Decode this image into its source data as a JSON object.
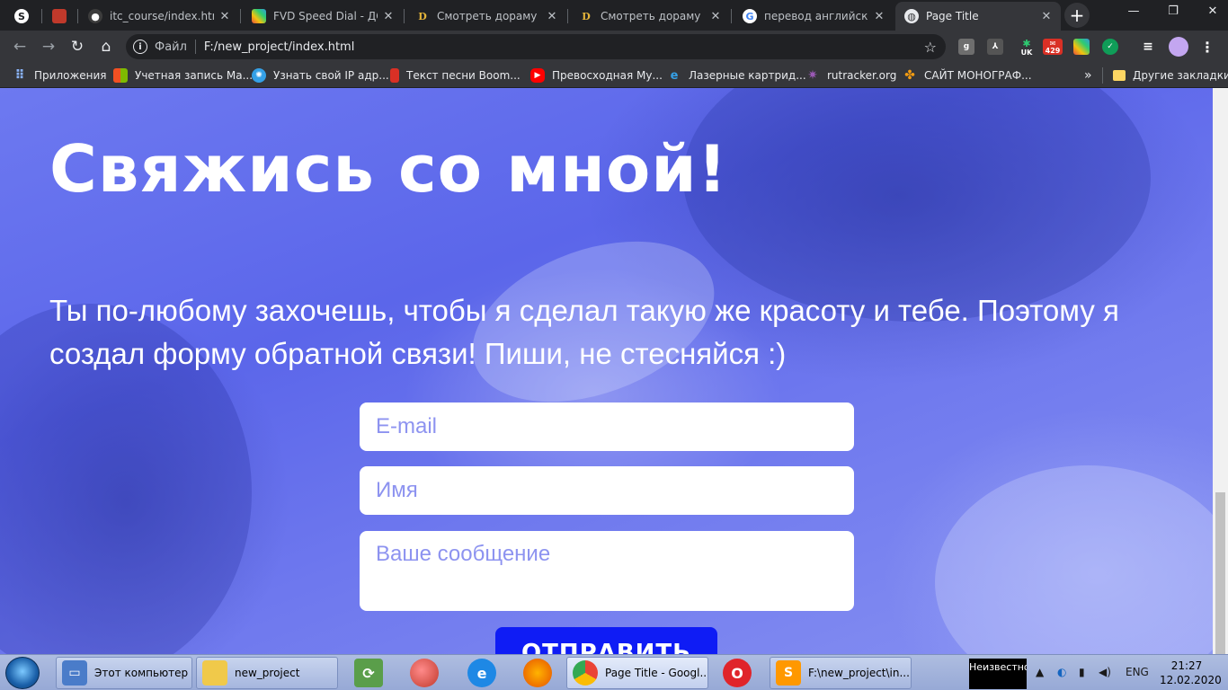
{
  "tabs": [
    {
      "title": "",
      "icon": "pinned-app-icon"
    },
    {
      "title": "",
      "icon": "pinned-site-icon"
    },
    {
      "title": "itc_course/index.html",
      "icon": "github-icon"
    },
    {
      "title": "FVD Speed Dial - ДОР",
      "icon": "speed-dial-icon"
    },
    {
      "title": "Смотреть дораму Ри",
      "icon": "dorama-icon"
    },
    {
      "title": "Смотреть дораму По",
      "icon": "dorama-icon"
    },
    {
      "title": "перевод английский",
      "icon": "google-icon"
    },
    {
      "title": "Page Title",
      "icon": "globe-icon"
    }
  ],
  "address": {
    "scheme": "Файл",
    "url": "F:/new_project/index.html"
  },
  "extensions": {
    "badge_uk": "UK",
    "badge_count": "429"
  },
  "bookmarks": [
    {
      "label": "Приложения",
      "icon": "apps-icon"
    },
    {
      "label": "Учетная запись Ма...",
      "icon": "microsoft-icon"
    },
    {
      "label": "Узнать свой IP адр...",
      "icon": "ip-icon"
    },
    {
      "label": "Текст песни Boom...",
      "icon": "lyrics-icon"
    },
    {
      "label": "Превосходная Му...",
      "icon": "youtube-icon"
    },
    {
      "label": "Лазерные картрид...",
      "icon": "cartridge-icon"
    },
    {
      "label": "rutracker.org",
      "icon": "rutracker-icon"
    },
    {
      "label": "САЙТ МОНОГРАФ...",
      "icon": "joomla-icon"
    }
  ],
  "bookmarks_more": "»",
  "bookmarks_other": "Другие закладки",
  "page": {
    "title": "Свяжись со мной!",
    "text": "Ты по-любому захочешь, чтобы я сделал такую же красоту и тебе. Поэтому я создал форму обратной связи! Пиши, не стесняйся :)",
    "email_placeholder": "E-mail",
    "name_placeholder": "Имя",
    "message_placeholder": "Ваше сообщение",
    "submit_label": "ОТПРАВИТЬ"
  },
  "taskbar": {
    "items": [
      {
        "label": "Этот компьютер",
        "icon": "computer-icon"
      },
      {
        "label": "new_project",
        "icon": "folder-icon"
      },
      {
        "label": "Page Title - Googl...",
        "icon": "chrome-icon"
      },
      {
        "label": "F:\\new_project\\in...",
        "icon": "sublime-icon"
      }
    ],
    "unknown_label": "Неизвестно",
    "lang": "ENG",
    "time": "21:27",
    "date": "12.02.2020"
  }
}
